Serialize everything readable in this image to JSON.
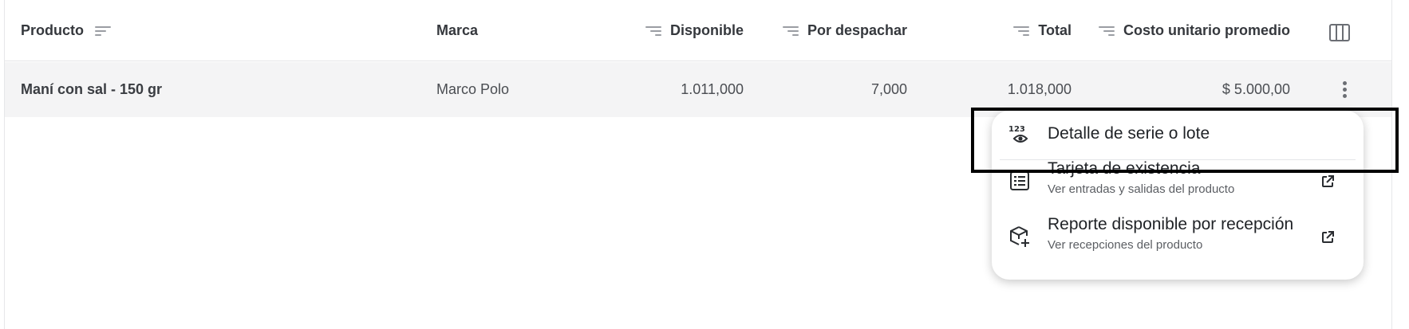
{
  "table": {
    "columns": [
      {
        "label": "Producto",
        "sort_icon": "sort-icon"
      },
      {
        "label": "Marca"
      },
      {
        "label": "Disponible",
        "sort_icon": "sort-icon"
      },
      {
        "label": "Por despachar",
        "sort_icon": "sort-icon"
      },
      {
        "label": "Total",
        "sort_icon": "sort-icon"
      },
      {
        "label": "Costo unitario promedio",
        "sort_icon": "sort-icon"
      }
    ],
    "columns_toggle_icon": "columns-icon",
    "rows": [
      {
        "producto": "Maní con sal - 150 gr",
        "marca": "Marco Polo",
        "disponible": "1.011,000",
        "por_despachar": "7,000",
        "total": "1.018,000",
        "costo": "$ 5.000,00",
        "actions_icon": "more-vertical-icon"
      }
    ]
  },
  "menu": {
    "items": [
      {
        "title": "Detalle de serie o lote",
        "icon": "serial-number-view-icon"
      },
      {
        "title": "Tarjeta de existencia",
        "subtitle": "Ver entradas y salidas del producto",
        "icon": "list-icon",
        "action_icon": "external-link-icon"
      },
      {
        "title": "Reporte disponible por recepción",
        "subtitle": "Ver recepciones del producto",
        "icon": "box-add-icon",
        "action_icon": "external-link-icon"
      }
    ]
  },
  "colors": {
    "row_background": "#f4f4f5",
    "highlight_border": "#000000",
    "header_text": "#35383d"
  }
}
